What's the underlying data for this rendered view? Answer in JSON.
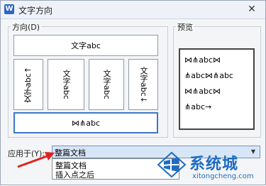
{
  "window": {
    "title": "文字方向",
    "app_icon_letter": "W",
    "close_glyph": "✕"
  },
  "direction_group": {
    "label": "方向(D)",
    "options": [
      {
        "text": "文字abc"
      },
      {
        "text": "文字abc↑"
      },
      {
        "text": "文字abc"
      },
      {
        "text": "文字abc"
      },
      {
        "text": "文字abc↓"
      },
      {
        "text": "⋈⋔abc"
      }
    ]
  },
  "preview_group": {
    "label": "预览",
    "lines": [
      "⋈⋔abc⋈",
      "⋔abc⋈⋔abc",
      "⋈⋔abc⋈",
      "⋔abc→"
    ]
  },
  "apply": {
    "label": "应用于(Y):",
    "selected": "整篇文档",
    "arrow_glyph": "▼",
    "dropdown_items": [
      "整篇文档",
      "插入点之后"
    ]
  },
  "watermark": {
    "name": "系统城",
    "site": "xitongcheng.com",
    "color": "#1f6dc2"
  },
  "colors": {
    "selection_border": "#3a79c6",
    "arrow": "#e02020"
  }
}
